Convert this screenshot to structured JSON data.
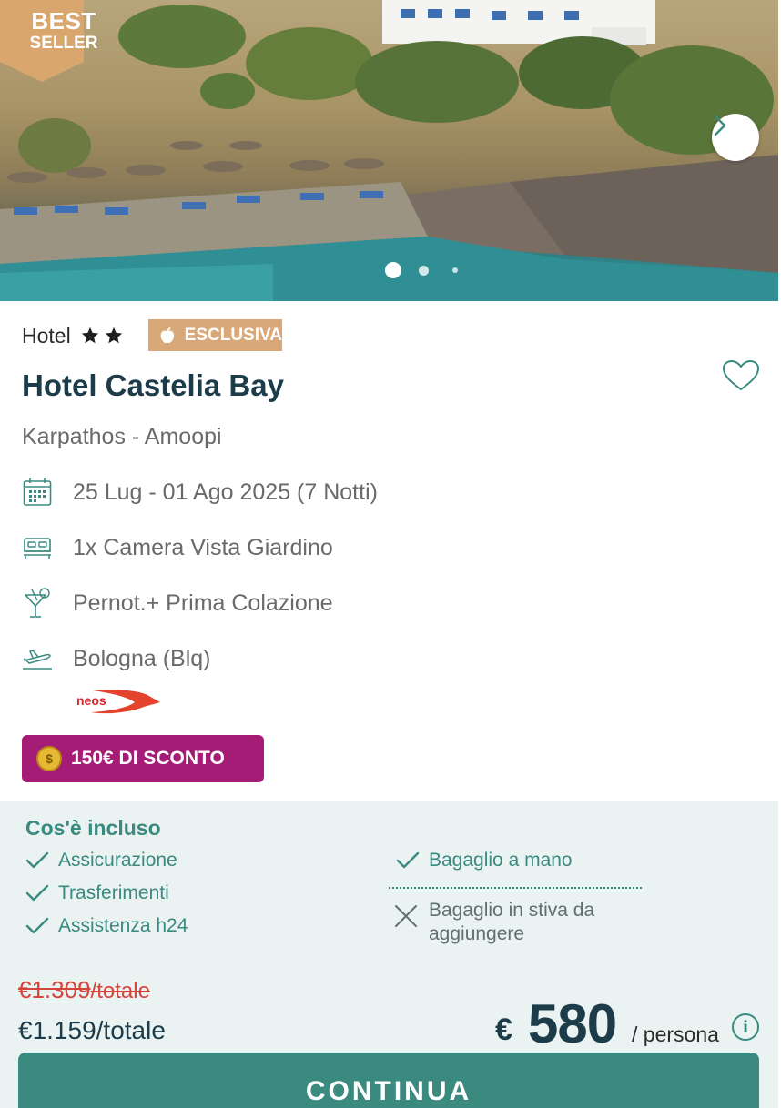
{
  "hero": {
    "badge_line1": "BEST",
    "badge_line2": "SELLER",
    "badge_color": "#d9a66e",
    "next_icon": "chevron-right-icon",
    "carousel_dots": 3,
    "active_dot": 1
  },
  "hotel": {
    "category": "Hotel",
    "stars": 2,
    "exclusive_label": "ESCLUSIVA",
    "name": "Hotel Castelia Bay",
    "location": "Karpathos - Amoopi",
    "favorite_icon": "heart-icon"
  },
  "details": {
    "dates": "25 Lug - 01 Ago 2025 (7 Notti)",
    "room": "1x Camera Vista Giardino",
    "board": "Pernot.+ Prima Colazione",
    "departure": "Bologna (Blq)",
    "airline": "neos"
  },
  "discount": {
    "label": "150€ DI SCONTO",
    "color": "#a51c76"
  },
  "included": {
    "title": "Cos'è incluso",
    "left_items": [
      "Assicurazione",
      "Trasferimenti",
      "Assistenza h24"
    ],
    "right_items": [
      "Bagaglio a mano"
    ],
    "not_included": "Bagaglio in stiva da aggiungere"
  },
  "price": {
    "old_total_symbol": "€",
    "old_total_value": "1.309",
    "old_total_suffix": "/totale",
    "total": "€1.159/totale",
    "currency": "€",
    "per_person": "580",
    "per_label": "/ persona"
  },
  "cta": {
    "label": "CONTINUA",
    "color": "#3a8a80"
  }
}
